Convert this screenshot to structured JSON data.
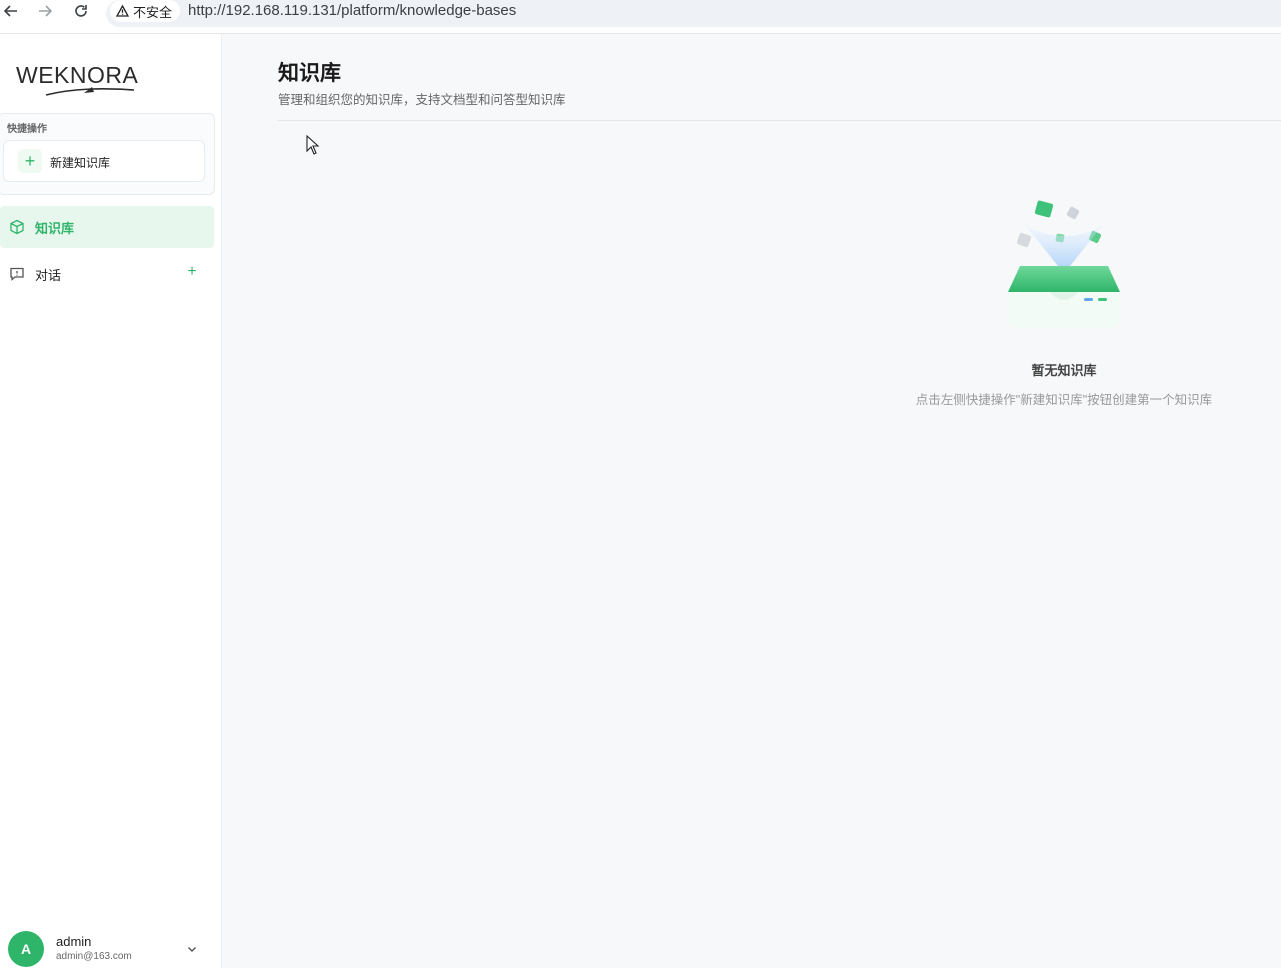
{
  "browser": {
    "security_label": "不安全",
    "url": "http://192.168.119.131/platform/knowledge-bases"
  },
  "sidebar": {
    "logo_text": "WEKNORA",
    "quick_actions": {
      "title": "快捷操作",
      "new_kb_label": "新建知识库"
    },
    "items": [
      {
        "label": "知识库",
        "active": true
      },
      {
        "label": "对话",
        "active": false
      }
    ],
    "user": {
      "initial": "A",
      "name": "admin",
      "email": "admin@163.com"
    }
  },
  "main": {
    "title": "知识库",
    "subtitle": "管理和组织您的知识库，支持文档型和问答型知识库",
    "empty": {
      "title": "暂无知识库",
      "description": "点击左侧快捷操作\"新建知识库\"按钮创建第一个知识库"
    }
  },
  "colors": {
    "accent": "#2fb56a",
    "accent_bg": "#e8f7ee",
    "main_bg": "#f7f8fa"
  }
}
